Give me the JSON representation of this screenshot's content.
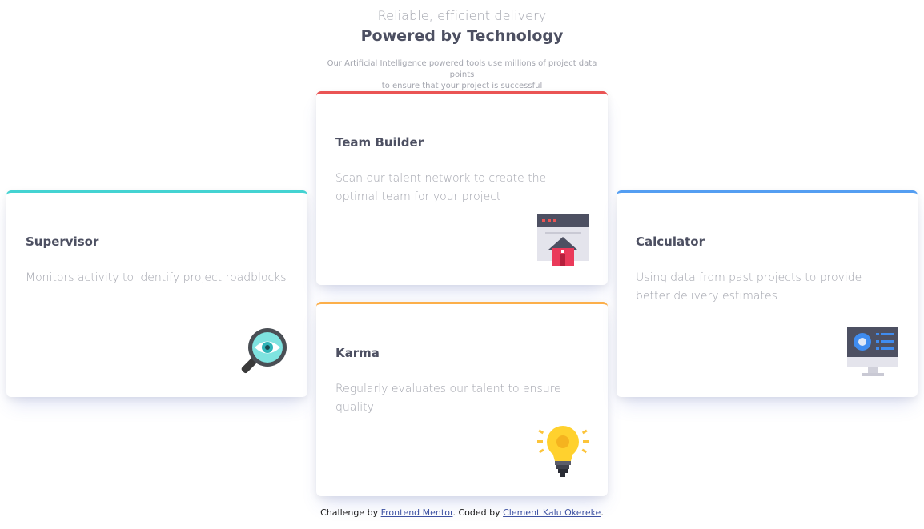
{
  "header": {
    "subtitle": "Reliable, efficient delivery",
    "title": "Powered by Technology",
    "description_line1": "Our Artificial Intelligence powered tools use millions of project data points",
    "description_line2": "to ensure that your project is successful"
  },
  "cards": {
    "supervisor": {
      "title": "Supervisor",
      "description": "Monitors activity to identify project roadblocks",
      "accent": "#44d3d2",
      "icon": "magnifier-eye-icon"
    },
    "team_builder": {
      "title": "Team Builder",
      "description": "Scan our talent network to create the optimal team for your project",
      "accent": "#ea5454",
      "icon": "browser-house-icon"
    },
    "karma": {
      "title": "Karma",
      "description": "Regularly evaluates our talent to ensure quality",
      "accent": "#fcaf4a",
      "icon": "lightbulb-icon"
    },
    "calculator": {
      "title": "Calculator",
      "description": "Using data from past projects to provide better delivery estimates",
      "accent": "#549ef2",
      "icon": "monitor-dashboard-icon"
    }
  },
  "footer": {
    "prefix": "Challenge by ",
    "challenge_link": "Frontend Mentor",
    "middle": ". Coded by ",
    "author_link": "Clement Kalu Okereke",
    "suffix": "."
  }
}
